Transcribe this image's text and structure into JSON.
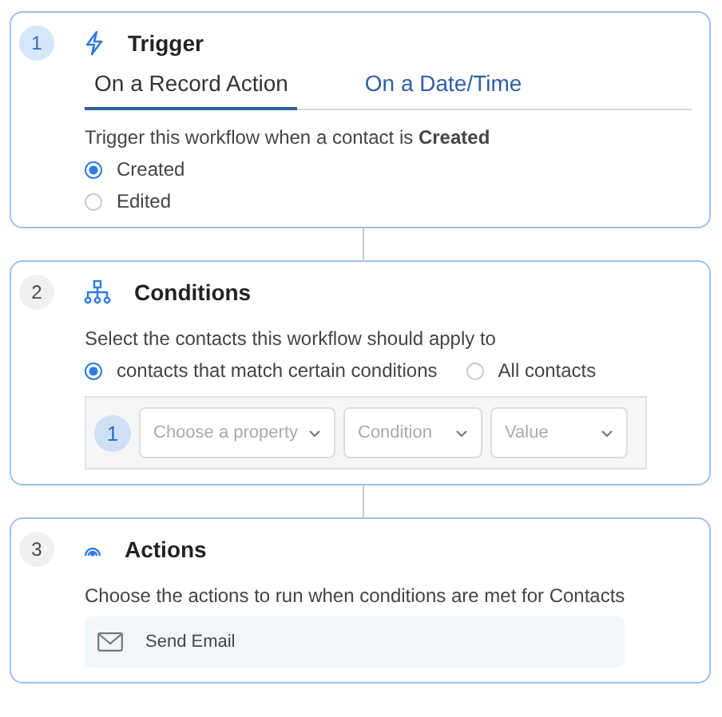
{
  "trigger": {
    "step": "1",
    "active": true,
    "title": "Trigger",
    "tabs": [
      {
        "label": "On a Record Action",
        "selected": true
      },
      {
        "label": "On a Date/Time",
        "selected": false
      }
    ],
    "description": "Trigger this workflow when a contact is **Created**",
    "options": [
      {
        "label": "Created",
        "selected": true
      },
      {
        "label": "Edited",
        "selected": false
      }
    ]
  },
  "conditions": {
    "step": "2",
    "active": false,
    "title": "Conditions",
    "description": "Select the contacts this workflow should apply to",
    "options": [
      {
        "label": "contacts that match certain conditions",
        "selected": true
      },
      {
        "label": "All contacts",
        "selected": false
      }
    ],
    "rule": {
      "number": "1",
      "property": {
        "placeholder": "Choose a property"
      },
      "condition": {
        "placeholder": "Condition"
      },
      "value": {
        "placeholder": "Value"
      }
    }
  },
  "actions": {
    "step": "3",
    "active": false,
    "title": "Actions",
    "description": "Choose the actions to run when conditions are met for Contacts",
    "items": [
      {
        "label": "Send Email"
      }
    ]
  }
}
